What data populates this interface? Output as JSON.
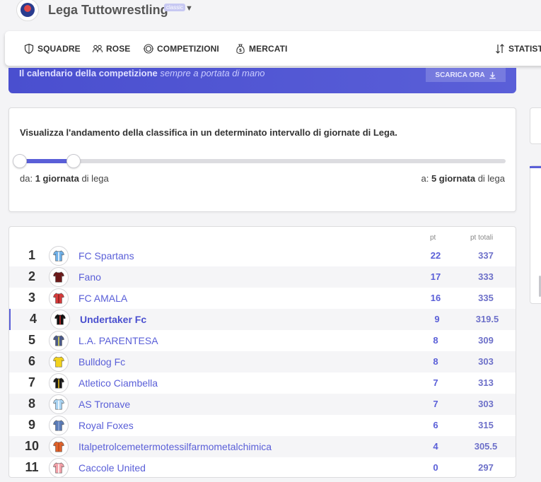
{
  "header": {
    "league_name": "Lega Tuttowrestling",
    "league_badge": "classic"
  },
  "nav": [
    {
      "label": "SQUADRE",
      "icon": "shield-icon"
    },
    {
      "label": "ROSE",
      "icon": "people-icon"
    },
    {
      "label": "COMPETIZIONI",
      "icon": "trophy-icon"
    },
    {
      "label": "MERCATI",
      "icon": "money-bag-icon"
    },
    {
      "label": "STATIST",
      "icon": "sort-arrows-icon"
    }
  ],
  "banner": {
    "text": "Il calendario della competizione",
    "em": "sempre a portata di mano",
    "button": "SCARICA ORA"
  },
  "range": {
    "description": "Visualizza l'andamento della classifica in un determinato intervallo di giornate di Lega.",
    "from_prefix": "da:",
    "from_value": "1 giornata",
    "from_suffix": "di lega",
    "to_prefix": "a:",
    "to_value": "5 giornata",
    "to_suffix": "di lega",
    "slider_from_fraction": 0.0,
    "slider_to_fraction": 0.11
  },
  "standings": {
    "col_pt": "pt",
    "col_tot": "pt totali",
    "rows": [
      {
        "rank": "1",
        "team": "FC Spartans",
        "pt": "22",
        "tot": "337",
        "color": "#6fb0e8",
        "stripe": "#ffffff"
      },
      {
        "rank": "2",
        "team": "Fano",
        "pt": "17",
        "tot": "333",
        "color": "#6b1a1a",
        "stripe": "#6b1a1a"
      },
      {
        "rank": "3",
        "team": "FC AMALA",
        "pt": "16",
        "tot": "335",
        "color": "#d63a3a",
        "stripe": "#8a1f1f"
      },
      {
        "rank": "4",
        "team": "Undertaker Fc",
        "pt": "9",
        "tot": "319.5",
        "color": "#111111",
        "stripe": "#d62b2b"
      },
      {
        "rank": "5",
        "team": "L.A. PARENTESA",
        "pt": "8",
        "tot": "309",
        "color": "#4a5a8a",
        "stripe": "#e8e04a"
      },
      {
        "rank": "6",
        "team": "Bulldog Fc",
        "pt": "8",
        "tot": "303",
        "color": "#f2d21c",
        "stripe": "#f2d21c"
      },
      {
        "rank": "7",
        "team": "Atletico Ciambella",
        "pt": "7",
        "tot": "313",
        "color": "#1a1a1a",
        "stripe": "#f0c419"
      },
      {
        "rank": "8",
        "team": "AS Tronave",
        "pt": "7",
        "tot": "303",
        "color": "#a9d3f2",
        "stripe": "#ffffff"
      },
      {
        "rank": "9",
        "team": "Royal Foxes",
        "pt": "6",
        "tot": "315",
        "color": "#5a7bb8",
        "stripe": "#8ea6d4"
      },
      {
        "rank": "10",
        "team": "Italpetrolcemetermotessilfarmometalchimica",
        "pt": "4",
        "tot": "305.5",
        "color": "#e0622a",
        "stripe": "#b84a1e"
      },
      {
        "rank": "11",
        "team": "Caccole United",
        "pt": "0",
        "tot": "297",
        "color": "#f2a0a8",
        "stripe": "#ffffff"
      }
    ]
  },
  "colors": {
    "accent": "#5a5fd8",
    "banner": "#4a4fcf"
  }
}
